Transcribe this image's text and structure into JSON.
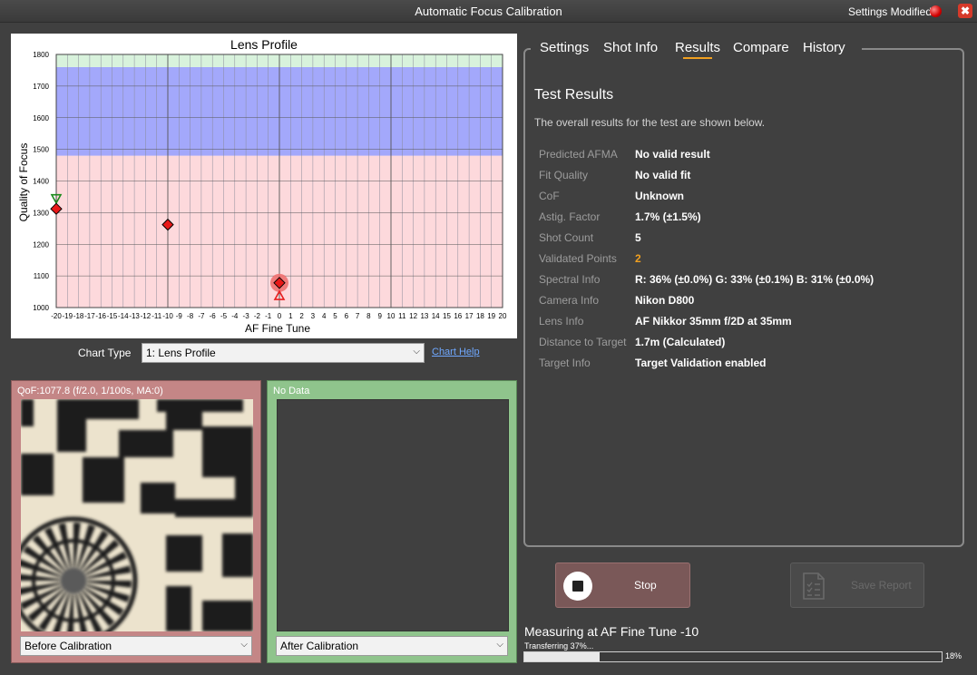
{
  "window": {
    "title": "Automatic Focus Calibration",
    "status": "Settings Modified",
    "close_glyph": "✖"
  },
  "chart": {
    "title": "Lens Profile",
    "xlabel": "AF Fine Tune",
    "ylabel": "Quality of Focus"
  },
  "chart_data": {
    "type": "scatter",
    "title": "Lens Profile",
    "xlabel": "AF Fine Tune",
    "ylabel": "Quality of Focus",
    "xlim": [
      -20,
      20
    ],
    "ylim": [
      1000,
      1800
    ],
    "x_ticks": [
      -20,
      -19,
      -18,
      -17,
      -16,
      -15,
      -14,
      -13,
      -12,
      -11,
      -10,
      -9,
      -8,
      -7,
      -6,
      -5,
      -4,
      -3,
      -2,
      -1,
      0,
      1,
      2,
      3,
      4,
      5,
      6,
      7,
      8,
      9,
      10,
      11,
      12,
      13,
      14,
      15,
      16,
      17,
      18,
      19,
      20
    ],
    "y_ticks": [
      1000,
      1100,
      1200,
      1300,
      1400,
      1500,
      1600,
      1700,
      1800
    ],
    "bands": [
      {
        "from": 1000,
        "to": 1480,
        "color": "#fdd9dc"
      },
      {
        "from": 1480,
        "to": 1760,
        "color": "#a3a8fb"
      },
      {
        "from": 1760,
        "to": 1800,
        "color": "#d8f2dc"
      }
    ],
    "points": [
      {
        "x": -20,
        "y": 1312
      },
      {
        "x": -10,
        "y": 1262
      },
      {
        "x": 0,
        "y": 1078
      }
    ],
    "highlight": {
      "x": 0,
      "y": 1078,
      "color": "#f07070"
    },
    "markers": [
      {
        "x": -20,
        "y": 1342,
        "shape": "triangle-down",
        "color": "#1a8a1a"
      },
      {
        "x": 0,
        "y": 1040,
        "shape": "triangle-up",
        "color": "#e82020"
      }
    ],
    "grid": true
  },
  "chart_type": {
    "label": "Chart Type",
    "selected": "1: Lens Profile",
    "help": "Chart Help"
  },
  "before": {
    "caption": "QoF:1077.8 (f/2.0, 1/100s, MA:0)",
    "select": "Before Calibration"
  },
  "after": {
    "caption": "No Data",
    "select": "After Calibration"
  },
  "tabs": [
    {
      "label": "Settings"
    },
    {
      "label": "Shot Info"
    },
    {
      "label": "Results"
    },
    {
      "label": "Compare"
    },
    {
      "label": "History"
    }
  ],
  "results": {
    "title": "Test Results",
    "subtitle": "The overall results for the test are shown below.",
    "rows": [
      {
        "key": "Predicted AFMA",
        "value": "No valid result"
      },
      {
        "key": "Fit Quality",
        "value": "No valid fit"
      },
      {
        "key": "CoF",
        "value": "Unknown"
      },
      {
        "key": "Astig. Factor",
        "value": "1.7% (±1.5%)"
      },
      {
        "key": "Shot Count",
        "value": "5"
      },
      {
        "key": "Validated Points",
        "value": "2"
      },
      {
        "key": "Spectral Info",
        "value": "R: 36% (±0.0%) G: 33% (±0.1%) B: 31% (±0.0%)"
      },
      {
        "key": "Camera Info",
        "value": "Nikon D800"
      },
      {
        "key": "Lens Info",
        "value": "AF Nikkor 35mm f/2D at 35mm"
      },
      {
        "key": "Distance to Target",
        "value": "1.7m (Calculated)"
      },
      {
        "key": "Target Info",
        "value": "Target Validation enabled"
      }
    ]
  },
  "buttons": {
    "stop": "Stop",
    "save_report": "Save Report"
  },
  "status": {
    "measuring": "Measuring at AF Fine Tune -10",
    "transferring": "Transferring 37%...",
    "progress": 0.18,
    "progress_label": "18%"
  }
}
